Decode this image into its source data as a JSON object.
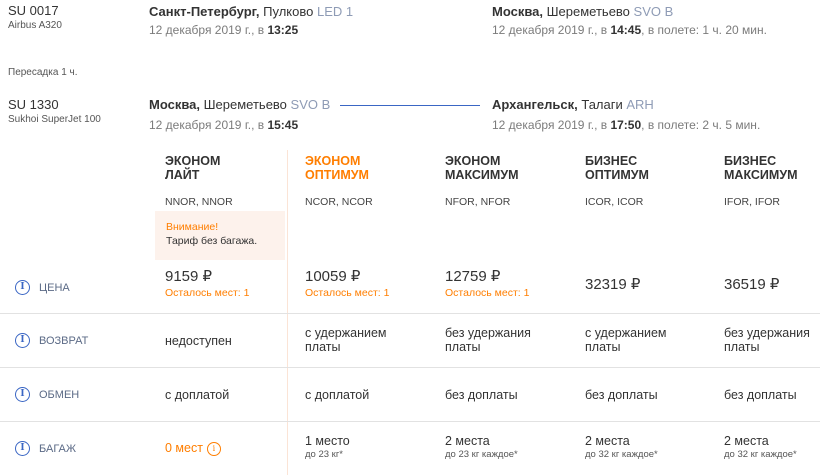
{
  "segments": [
    {
      "flight": "SU 0017",
      "aircraft": "Airbus A320",
      "from_city": "Санкт-Петербург,",
      "from_airport": "Пулково",
      "from_code": "LED 1",
      "from_date": "12 декабря 2019 г., в",
      "from_time": "13:25",
      "to_city": "Москва,",
      "to_airport": "Шереметьево",
      "to_code": "SVO B",
      "to_date": "12 декабря 2019 г., в",
      "to_time": "14:45",
      "duration": ", в полете: 1 ч. 20 мин."
    },
    {
      "flight": "SU 1330",
      "aircraft": "Sukhoi SuperJet 100",
      "from_city": "Москва,",
      "from_airport": "Шереметьево",
      "from_code": "SVO B",
      "from_date": "12 декабря 2019 г., в",
      "from_time": "15:45",
      "to_city": "Архангельск,",
      "to_airport": "Талаги",
      "to_code": "ARH",
      "to_date": "12 декабря 2019 г., в",
      "to_time": "17:50",
      "duration": ", в полете: 2 ч. 5 мин."
    }
  ],
  "transfer": "Пересадка 1 ч.",
  "tariffs": [
    {
      "name1": "ЭКОНОМ",
      "name2": "ЛАЙТ",
      "codes": "NNOR, NNOR"
    },
    {
      "name1": "ЭКОНОМ",
      "name2": "ОПТИМУМ",
      "codes": "NCOR, NCOR"
    },
    {
      "name1": "ЭКОНОМ",
      "name2": "МАКСИМУМ",
      "codes": "NFOR, NFOR"
    },
    {
      "name1": "БИЗНЕС",
      "name2": "ОПТИМУМ",
      "codes": "ICOR, ICOR"
    },
    {
      "name1": "БИЗНЕС",
      "name2": "МАКСИМУМ",
      "codes": "IFOR, IFOR"
    }
  ],
  "warning": {
    "title": "Внимание!",
    "text": "Тариф без багажа."
  },
  "rows": {
    "price": "ЦЕНА",
    "refund": "ВОЗВРАТ",
    "exchange": "ОБМЕН",
    "baggage": "БАГАЖ"
  },
  "prices": [
    {
      "value": "9159 ₽",
      "seats": "Осталось мест: 1"
    },
    {
      "value": "10059 ₽",
      "seats": "Осталось мест: 1"
    },
    {
      "value": "12759 ₽",
      "seats": "Осталось мест: 1"
    },
    {
      "value": "32319 ₽",
      "seats": ""
    },
    {
      "value": "36519 ₽",
      "seats": ""
    }
  ],
  "refund": [
    {
      "l1": "недоступен",
      "l2": ""
    },
    {
      "l1": "с удержанием",
      "l2": "платы"
    },
    {
      "l1": "без удержания",
      "l2": "платы"
    },
    {
      "l1": "с удержанием",
      "l2": "платы"
    },
    {
      "l1": "без удержания",
      "l2": "платы"
    }
  ],
  "exchange": [
    "с доплатой",
    "с доплатой",
    "без доплаты",
    "без доплаты",
    "без доплаты"
  ],
  "baggage": [
    {
      "l1": "0 мест",
      "l2": ""
    },
    {
      "l1": "1 место",
      "l2": "до 23 кг*"
    },
    {
      "l1": "2 места",
      "l2": "до 23 кг каждое*"
    },
    {
      "l1": "2 места",
      "l2": "до 32 кг каждое*"
    },
    {
      "l1": "2 места",
      "l2": "до 32 кг каждое*"
    }
  ],
  "colors": {
    "accent": "#ff7e00",
    "link": "#3a66c4"
  }
}
